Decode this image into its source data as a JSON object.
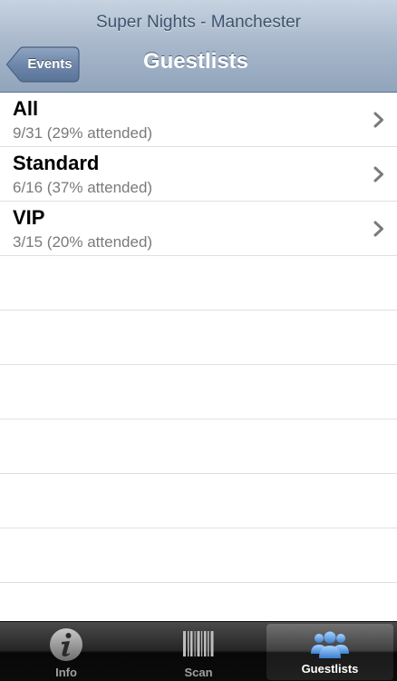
{
  "navbar": {
    "subtitle": "Super Nights - Manchester",
    "title": "Guestlists",
    "back_label": "Events"
  },
  "guestlists": [
    {
      "name": "All",
      "stats": "9/31 (29% attended)"
    },
    {
      "name": "Standard",
      "stats": "6/16 (37% attended)"
    },
    {
      "name": "VIP",
      "stats": "3/15 (20% attended)"
    }
  ],
  "tabs": [
    {
      "label": "Info",
      "icon": "info-icon"
    },
    {
      "label": "Scan",
      "icon": "barcode-icon"
    },
    {
      "label": "Guestlists",
      "icon": "people-icon",
      "selected": true
    }
  ],
  "colors": {
    "navbar_top": "#c7d3e0",
    "navbar_bottom": "#90a4bb",
    "selected_tab_icon": "#5aa0e6",
    "chevron": "#7a7a7a"
  }
}
